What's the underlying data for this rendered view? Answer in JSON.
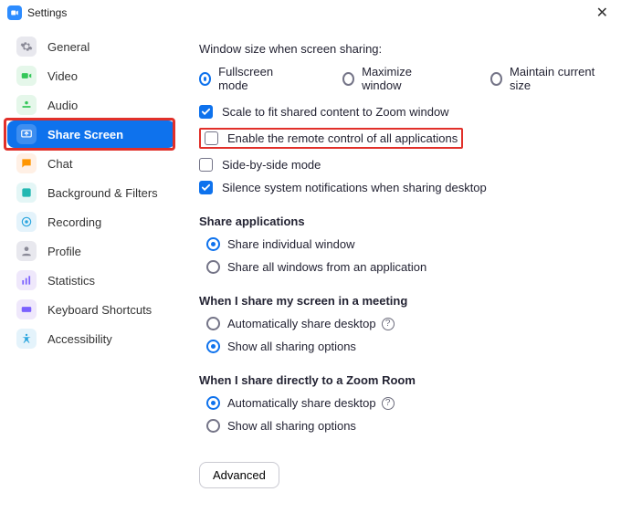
{
  "window": {
    "title": "Settings"
  },
  "sidebar": {
    "items": [
      {
        "id": "general",
        "label": "General"
      },
      {
        "id": "video",
        "label": "Video"
      },
      {
        "id": "audio",
        "label": "Audio"
      },
      {
        "id": "share",
        "label": "Share Screen"
      },
      {
        "id": "chat",
        "label": "Chat"
      },
      {
        "id": "bgfilters",
        "label": "Background & Filters"
      },
      {
        "id": "recording",
        "label": "Recording"
      },
      {
        "id": "profile",
        "label": "Profile"
      },
      {
        "id": "statistics",
        "label": "Statistics"
      },
      {
        "id": "shortcuts",
        "label": "Keyboard Shortcuts"
      },
      {
        "id": "access",
        "label": "Accessibility"
      }
    ]
  },
  "share_screen": {
    "window_size_label": "Window size when screen sharing:",
    "radios_size": {
      "fullscreen": "Fullscreen mode",
      "maximize": "Maximize window",
      "maintain": "Maintain current size"
    },
    "checks": {
      "scale": "Scale to fit shared content to Zoom window",
      "remote": "Enable the remote control of all applications",
      "sidebyside": "Side-by-side mode",
      "silence": "Silence system notifications when sharing desktop"
    },
    "share_apps_head": "Share applications",
    "share_apps": {
      "individual": "Share individual window",
      "allfromapp": "Share all windows from an application"
    },
    "meeting_head": "When I share my screen in a meeting",
    "meeting": {
      "auto": "Automatically share desktop",
      "all": "Show all sharing options"
    },
    "zoomroom_head": "When I share directly to a Zoom Room",
    "zoomroom": {
      "auto": "Automatically share desktop",
      "all": "Show all sharing options"
    },
    "advanced_btn": "Advanced"
  }
}
